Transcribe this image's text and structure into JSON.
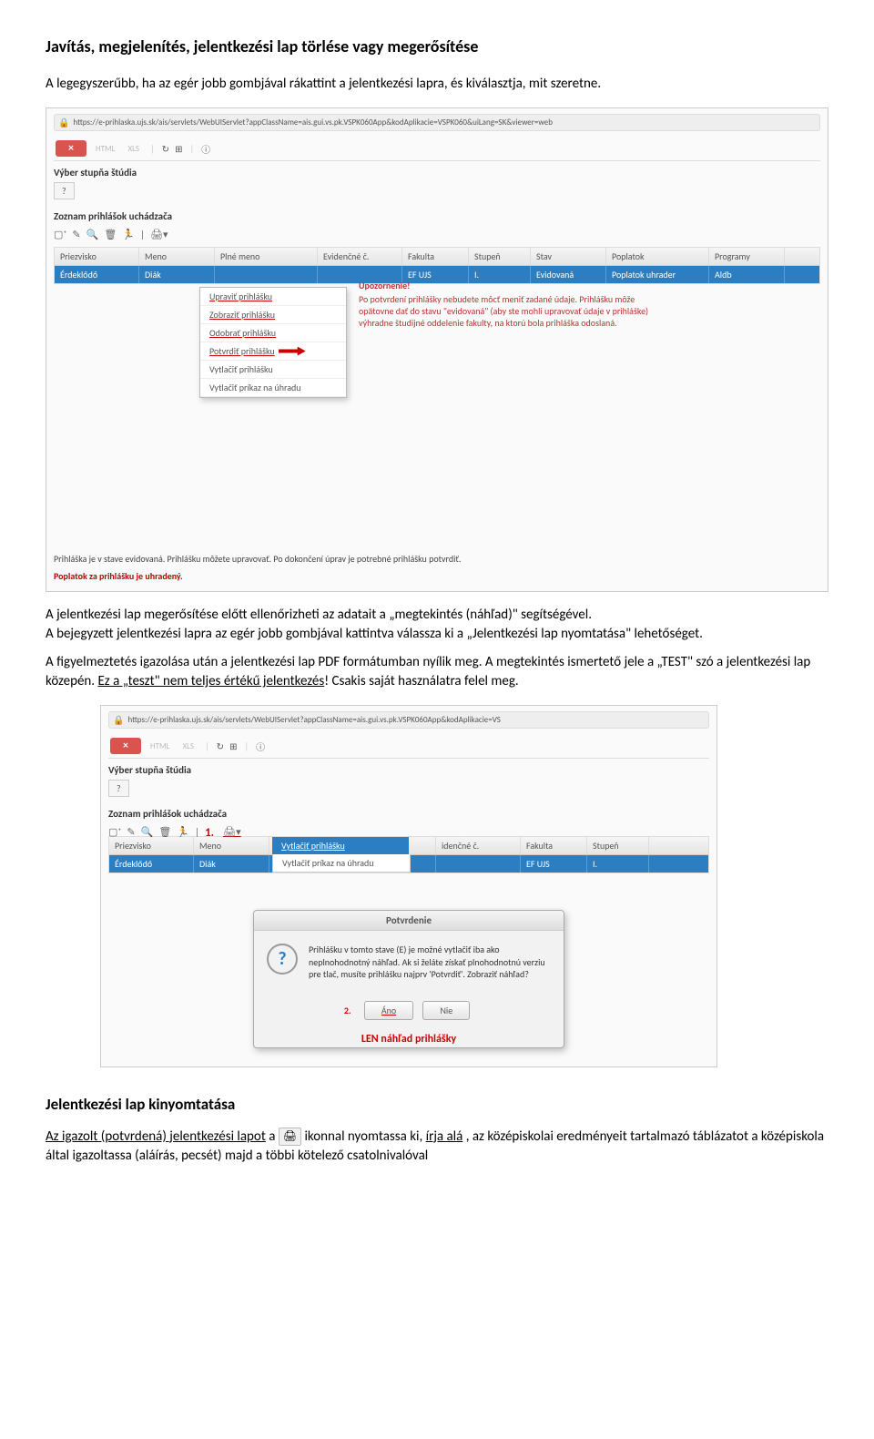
{
  "heading": "Javítás, megjelenítés, jelentkezési lap törlése vagy megerősítése",
  "intro": "A legegyszerűbb, ha az egér jobb gombjával rákattint a jelentkezési lapra, és kiválasztja, mit szeretne.",
  "shot1": {
    "url": "https://e-prihlaska.ujs.sk/ais/servlets/WebUIServlet?appClassName=ais.gui.vs.pk.VSPK060App&kodAplikacie=VSPK060&uiLang=SK&viewer=web",
    "close": "×",
    "btn_html": "HTML",
    "btn_xls": "XLS",
    "sec_vyber": "Výber stupňa štúdia",
    "q": "?",
    "sec_zoznam": "Zoznam prihlášok uchádzača",
    "headers": [
      "Priezvisko",
      "Meno",
      "Plné meno",
      "Evidenčné č.",
      "Fakulta",
      "Stupeň",
      "Stav",
      "Poplatok",
      "Programy"
    ],
    "row": [
      "Érdeklődő",
      "Diák",
      "",
      "",
      "EF UJS",
      "I.",
      "Evidovaná",
      "Poplatok uhrader",
      "Aldb"
    ],
    "menu": {
      "m1": "Upraviť prihlášku",
      "m2": "Zobraziť prihlášku",
      "m3": "Odobrať prihlášku",
      "m4": "Potvrdiť prihlášku",
      "m5": "Vytlačiť prihlášku",
      "m6": "Vytlačiť príkaz na úhradu"
    },
    "warn_title": "Upozornenie!",
    "warn_text": "Po potvrdení prihlášky nebudete môcť meniť zadané údaje. Prihlášku môže opätovne dať do stavu \"evidovaná\" (aby ste mohli upravovať údaje v prihláške) výhradne študijné oddelenie fakulty, na ktorú bola prihláška odoslaná.",
    "status": "Prihláška je v stave evidovaná. Prihlášku môžete upravovať. Po dokončení úprav je potrebné prihlášku potvrdiť.",
    "status2": "Poplatok za prihlášku je uhradený."
  },
  "mid_text": {
    "p1_a": "A jelentkezési lap megerősítése előtt ellenőrizheti az adatait a „megtekintés (náhľad)\" segítségével.",
    "p1_b": "A bejegyzett jelentkezési lapra az egér jobb gombjával kattintva válassza ki a „Jelentkezési lap nyomtatása\" lehetőséget.",
    "p2_a": "A figyelmeztetés igazolása után a jelentkezési lap PDF formátumban nyílik meg. A megtekintés ismertető jele a „TEST\" szó a jelentkezési lap közepén. ",
    "p2_b": "Ez a „teszt\" nem teljes értékű jelentkezés",
    "p2_c": "! Csakis saját használatra felel meg."
  },
  "shot2": {
    "url": "https://e-prihlaska.ujs.sk/ais/servlets/WebUIServlet?appClassName=ais.gui.vs.pk.VSPK060App&kodAplikacie=VS",
    "sec_vyber": "Výber stupňa štúdia",
    "sec_zoznam": "Zoznam prihlášok uchádzača",
    "annot1": "1.",
    "dd_active": "Vytlačiť prihlášku",
    "dd_item": "Vytlačiť príkaz na úhradu",
    "headers": [
      "Priezvisko",
      "Meno",
      "",
      "idenčné č.",
      "Fakulta",
      "Stupeň"
    ],
    "row": [
      "Érdeklődő",
      "Diák",
      "",
      "",
      "EF UJS",
      "I."
    ],
    "dialog_title": "Potvrdenie",
    "dialog_text": "Prihlášku v tomto stave (E) je možné vytlačiť iba ako neplnohodnotný náhľad. Ak si želáte získať plnohodnotnú verziu pre tlač, musíte prihlášku najprv 'Potvrdiť'. Zobraziť náhľad?",
    "annot2": "2.",
    "btn_yes": "Áno",
    "btn_no": "Nie",
    "caption": "LEN náhľad prihlášky"
  },
  "heading2": "Jelentkezési lap kinyomtatása",
  "out_text": {
    "a": "Az igazolt (potvrdená) jelentkezési lapot",
    "b": " a ",
    "c": " ikonnal nyomtassa ki, ",
    "d": "írja alá",
    "e": ", az középiskolai eredményeit tartalmazó táblázatot a középiskola által igazoltassa (aláírás, pecsét) majd a többi kötelező csatolnivalóval"
  }
}
